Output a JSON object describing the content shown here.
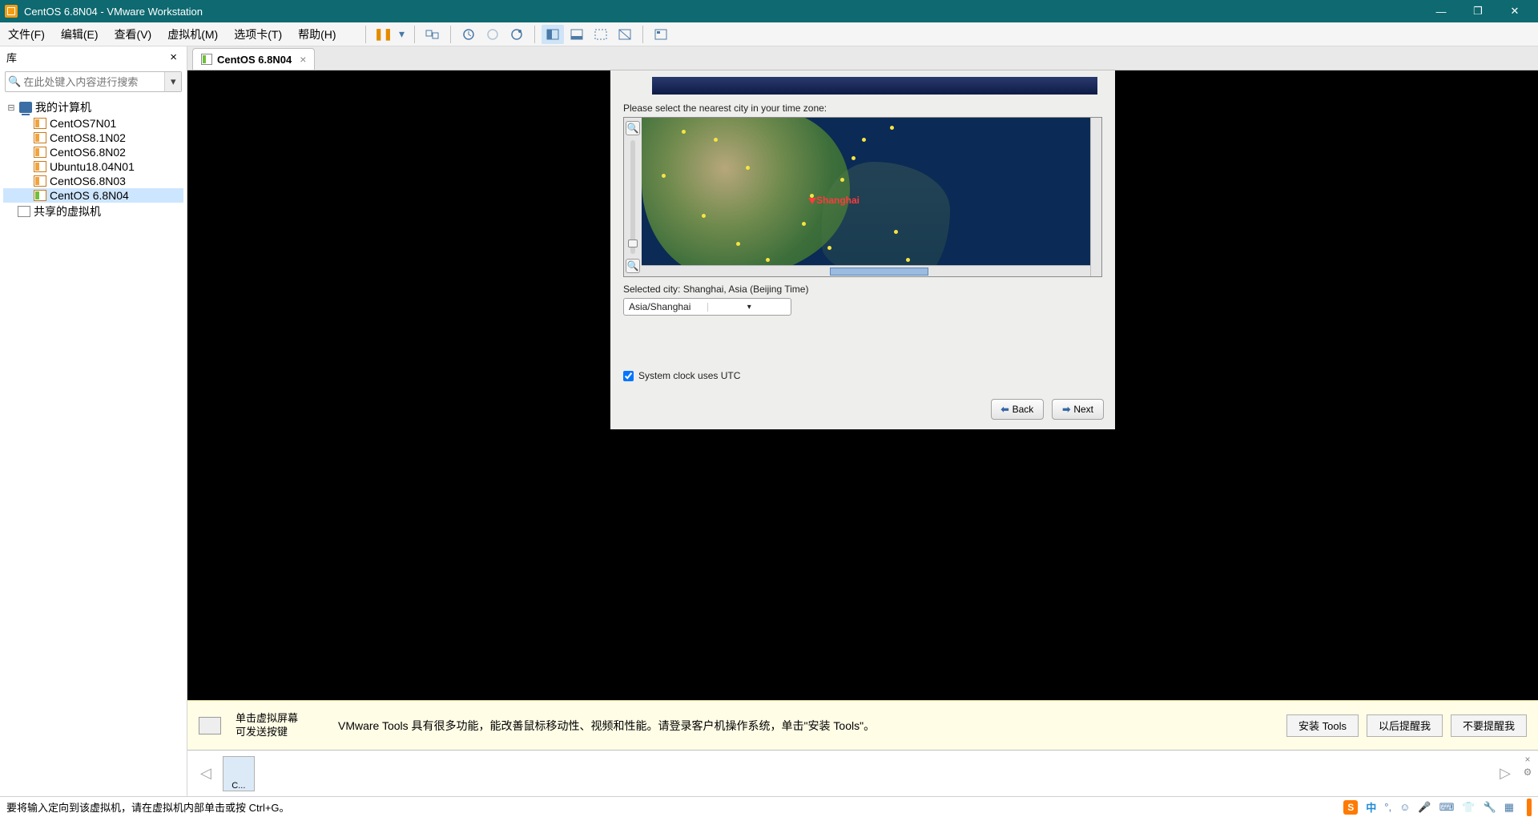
{
  "titlebar": {
    "title": "CentOS 6.8N04 - VMware Workstation"
  },
  "menu": {
    "file": "文件(F)",
    "edit": "编辑(E)",
    "view": "查看(V)",
    "vm": "虚拟机(M)",
    "tabs": "选项卡(T)",
    "help": "帮助(H)"
  },
  "sidebar": {
    "header": "库",
    "search_placeholder": "在此处键入内容进行搜索",
    "root": "我的计算机",
    "shared": "共享的虚拟机",
    "items": [
      {
        "label": "CentOS7N01"
      },
      {
        "label": "CentOS8.1N02"
      },
      {
        "label": "CentOS6.8N02"
      },
      {
        "label": "Ubuntu18.04N01"
      },
      {
        "label": "CentOS6.8N03"
      },
      {
        "label": "CentOS 6.8N04"
      }
    ]
  },
  "tab": {
    "label": "CentOS 6.8N04"
  },
  "installer": {
    "prompt": "Please select the nearest city in your time zone:",
    "selected_label": "Selected city: Shanghai, Asia (Beijing Time)",
    "combo": "Asia/Shanghai",
    "utc_label": "System clock uses UTC",
    "city_marker": "Shanghai",
    "back": "Back",
    "next": "Next"
  },
  "tools": {
    "hint": "单击虚拟屏幕\n可发送按键",
    "msg": "VMware Tools 具有很多功能，能改善鼠标移动性、视频和性能。请登录客户机操作系统，单击\"安装 Tools\"。",
    "install": "安装 Tools",
    "later": "以后提醒我",
    "never": "不要提醒我"
  },
  "thumb": {
    "label": "C..."
  },
  "status": {
    "msg": "要将输入定向到该虚拟机，请在虚拟机内部单击或按 Ctrl+G。",
    "ime": "中"
  }
}
